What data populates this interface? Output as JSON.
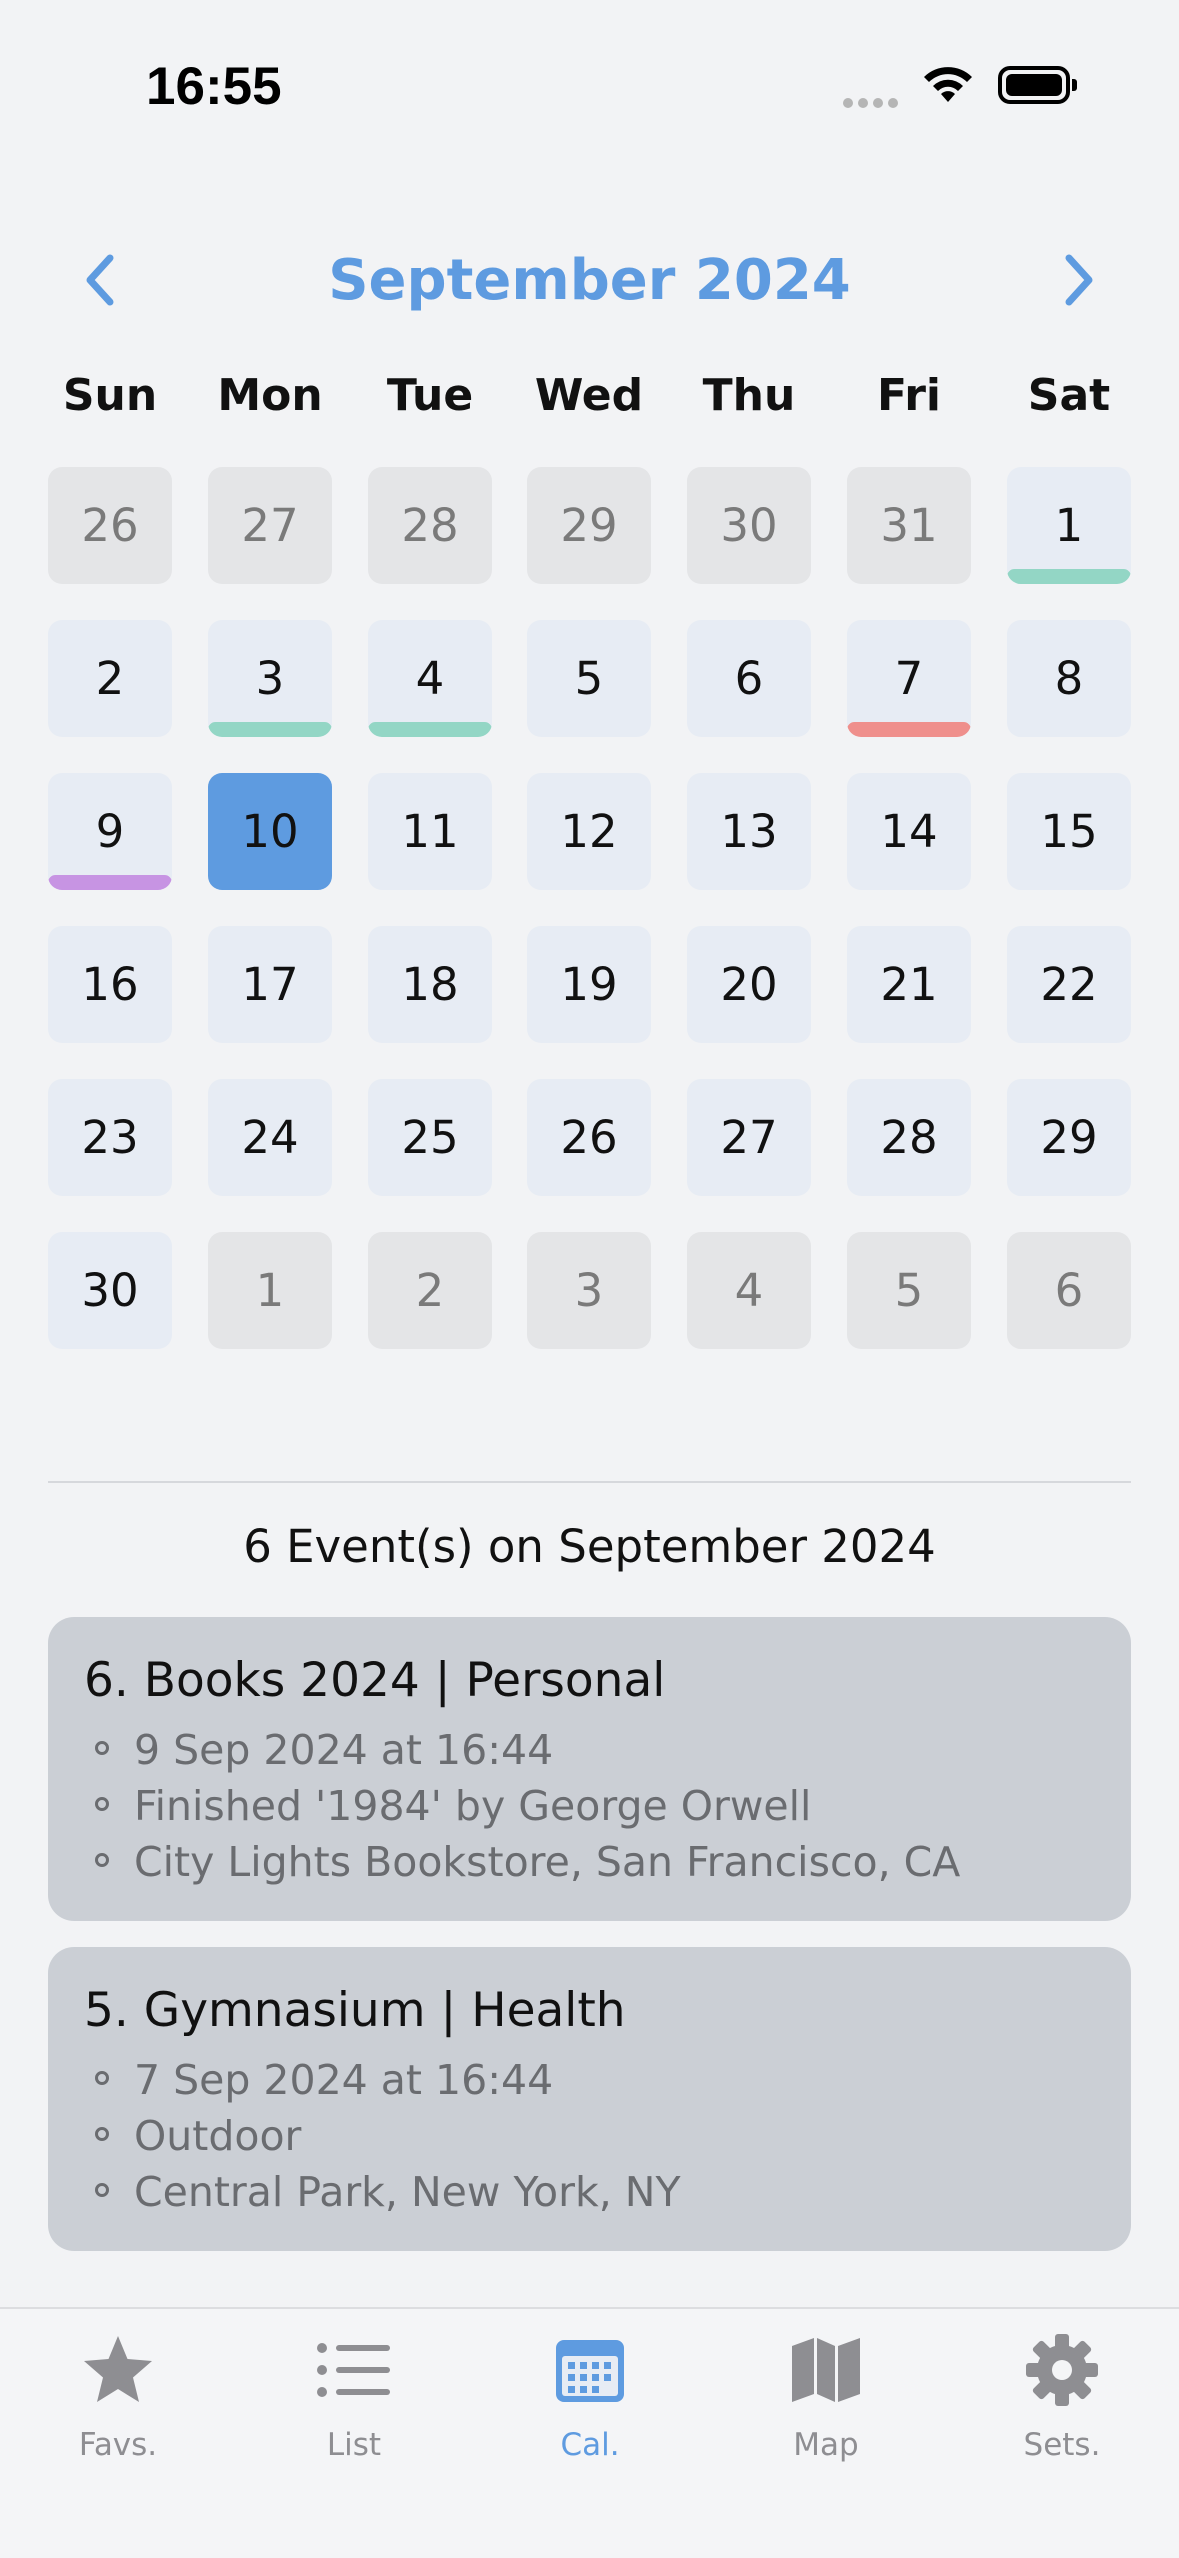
{
  "status_bar": {
    "time": "16:55"
  },
  "calendar": {
    "month_title": "September 2024",
    "weekdays": [
      "Sun",
      "Mon",
      "Tue",
      "Wed",
      "Thu",
      "Fri",
      "Sat"
    ],
    "weeks": [
      [
        {
          "d": "26",
          "outside": true
        },
        {
          "d": "27",
          "outside": true
        },
        {
          "d": "28",
          "outside": true
        },
        {
          "d": "29",
          "outside": true
        },
        {
          "d": "30",
          "outside": true
        },
        {
          "d": "31",
          "outside": true
        },
        {
          "d": "1",
          "marker": "#93d6c5"
        }
      ],
      [
        {
          "d": "2"
        },
        {
          "d": "3",
          "marker": "#93d6c5"
        },
        {
          "d": "4",
          "marker": "#93d6c5"
        },
        {
          "d": "5"
        },
        {
          "d": "6"
        },
        {
          "d": "7",
          "marker": "#ef8f8c"
        },
        {
          "d": "8"
        }
      ],
      [
        {
          "d": "9",
          "marker": "#c794e3"
        },
        {
          "d": "10",
          "selected": true
        },
        {
          "d": "11"
        },
        {
          "d": "12"
        },
        {
          "d": "13"
        },
        {
          "d": "14"
        },
        {
          "d": "15"
        }
      ],
      [
        {
          "d": "16"
        },
        {
          "d": "17"
        },
        {
          "d": "18"
        },
        {
          "d": "19"
        },
        {
          "d": "20"
        },
        {
          "d": "21"
        },
        {
          "d": "22"
        }
      ],
      [
        {
          "d": "23"
        },
        {
          "d": "24"
        },
        {
          "d": "25"
        },
        {
          "d": "26"
        },
        {
          "d": "27"
        },
        {
          "d": "28"
        },
        {
          "d": "29"
        }
      ],
      [
        {
          "d": "30"
        },
        {
          "d": "1",
          "outside": true
        },
        {
          "d": "2",
          "outside": true
        },
        {
          "d": "3",
          "outside": true
        },
        {
          "d": "4",
          "outside": true
        },
        {
          "d": "5",
          "outside": true
        },
        {
          "d": "6",
          "outside": true
        }
      ]
    ]
  },
  "events": {
    "summary": "6 Event(s) on September 2024",
    "items": [
      {
        "title": "6. Books 2024 | Personal",
        "lines": [
          "9 Sep 2024 at 16:44",
          "Finished '1984' by George Orwell",
          "City Lights Bookstore, San Francisco, CA"
        ]
      },
      {
        "title": "5. Gymnasium | Health",
        "lines": [
          "7 Sep 2024 at 16:44",
          "Outdoor",
          "Central Park, New York, NY"
        ]
      }
    ]
  },
  "tab_bar": {
    "tabs": [
      {
        "label": "Favs.",
        "icon": "star-icon",
        "active": false
      },
      {
        "label": "List",
        "icon": "list-icon",
        "active": false
      },
      {
        "label": "Cal.",
        "icon": "calendar-icon",
        "active": true
      },
      {
        "label": "Map",
        "icon": "map-icon",
        "active": false
      },
      {
        "label": "Sets.",
        "icon": "gear-icon",
        "active": false
      }
    ]
  },
  "colors": {
    "accent": "#5e9be0",
    "day_bg": "#e7ecf4",
    "outside_day_bg": "#e4e5e7",
    "card_bg": "#cbcfd5",
    "icon_gray": "#8e8e92"
  }
}
